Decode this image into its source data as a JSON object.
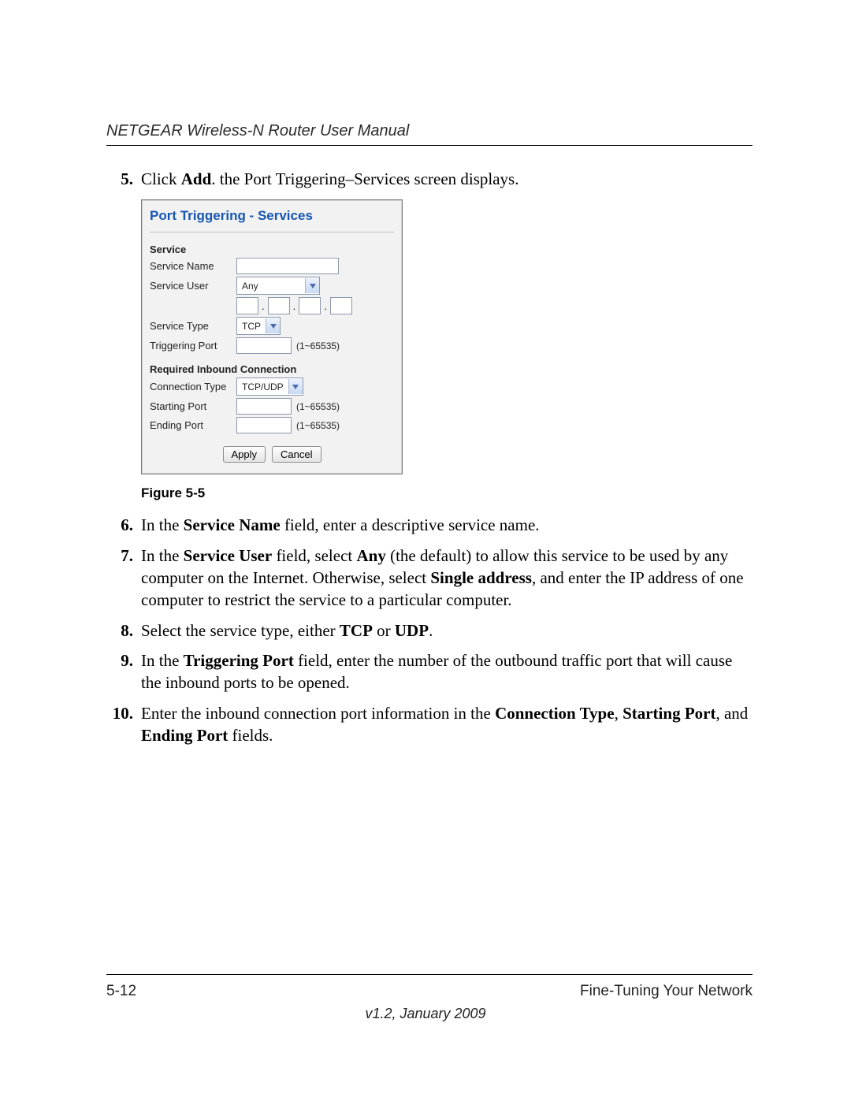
{
  "header": {
    "title": "NETGEAR Wireless-N Router User Manual"
  },
  "steps": {
    "s5": {
      "num": "5.",
      "pre": "Click ",
      "b1": "Add",
      "post": ". the Port Triggering–Services screen displays."
    },
    "s6": {
      "num": "6.",
      "pre": "In the ",
      "b1": "Service Name",
      "post": " field, enter a descriptive service name."
    },
    "s7": {
      "num": "7.",
      "pre": "In the ",
      "b1": "Service User",
      "mid1": " field, select ",
      "b2": "Any",
      "mid2": " (the default) to allow this service to be used by any computer on the Internet. Otherwise, select ",
      "b3": "Single address",
      "post": ", and enter the IP address of one computer to restrict the service to a particular computer."
    },
    "s8": {
      "num": "8.",
      "pre": "Select the service type, either ",
      "b1": "TCP",
      "mid": " or ",
      "b2": "UDP",
      "post": "."
    },
    "s9": {
      "num": "9.",
      "pre": "In the ",
      "b1": "Triggering Port",
      "post": " field, enter the number of the outbound traffic port that will cause the inbound ports to be opened."
    },
    "s10": {
      "num": "10.",
      "pre": "Enter the inbound connection port information in the ",
      "b1": "Connection Type",
      "mid1": ", ",
      "b2": "Starting Port",
      "mid2": ", and ",
      "b3": "Ending Port",
      "post": " fields."
    }
  },
  "figure": {
    "caption": "Figure 5-5",
    "panel_title": "Port Triggering - Services",
    "section_service": "Service",
    "labels": {
      "service_name": "Service Name",
      "service_user": "Service User",
      "service_type": "Service Type",
      "triggering_port": "Triggering Port",
      "required_inbound": "Required Inbound Connection",
      "connection_type": "Connection Type",
      "starting_port": "Starting Port",
      "ending_port": "Ending Port"
    },
    "values": {
      "service_user": "Any",
      "service_type": "TCP",
      "connection_type": "TCP/UDP"
    },
    "hints": {
      "port_range": "(1~65535)"
    },
    "buttons": {
      "apply": "Apply",
      "cancel": "Cancel"
    }
  },
  "footer": {
    "page_num": "5-12",
    "section": "Fine-Tuning Your Network",
    "version": "v1.2, January 2009"
  }
}
